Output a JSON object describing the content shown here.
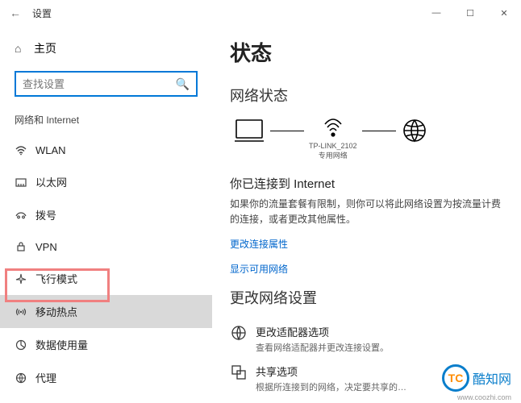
{
  "titleBar": {
    "back": "←",
    "title": "设置",
    "min": "—",
    "max": "☐",
    "close": "✕"
  },
  "sidebar": {
    "home": "主页",
    "searchPlaceholder": "查找设置",
    "category": "网络和 Internet",
    "items": [
      {
        "label": "WLAN"
      },
      {
        "label": "以太网"
      },
      {
        "label": "拨号"
      },
      {
        "label": "VPN"
      },
      {
        "label": "飞行模式"
      },
      {
        "label": "移动热点"
      },
      {
        "label": "数据使用量"
      },
      {
        "label": "代理"
      }
    ]
  },
  "main": {
    "pageTitle": "状态",
    "section1": "网络状态",
    "diagram": {
      "ssid": "TP-LINK_2102",
      "netType": "专用网络"
    },
    "connectedTitle": "你已连接到 Internet",
    "connectedDesc": "如果你的流量套餐有限制，则你可以将此网络设置为按流量计费的连接，或者更改其他属性。",
    "link1": "更改连接属性",
    "link2": "显示可用网络",
    "section2": "更改网络设置",
    "opts": [
      {
        "t1": "更改适配器选项",
        "t2": "查看网络适配器并更改连接设置。"
      },
      {
        "t1": "共享选项",
        "t2": "根据所连接到的网络，决定要共享的…"
      }
    ]
  },
  "watermark": {
    "logo": "TC",
    "text": "酷知网",
    "url": "www.coozhi.com"
  }
}
